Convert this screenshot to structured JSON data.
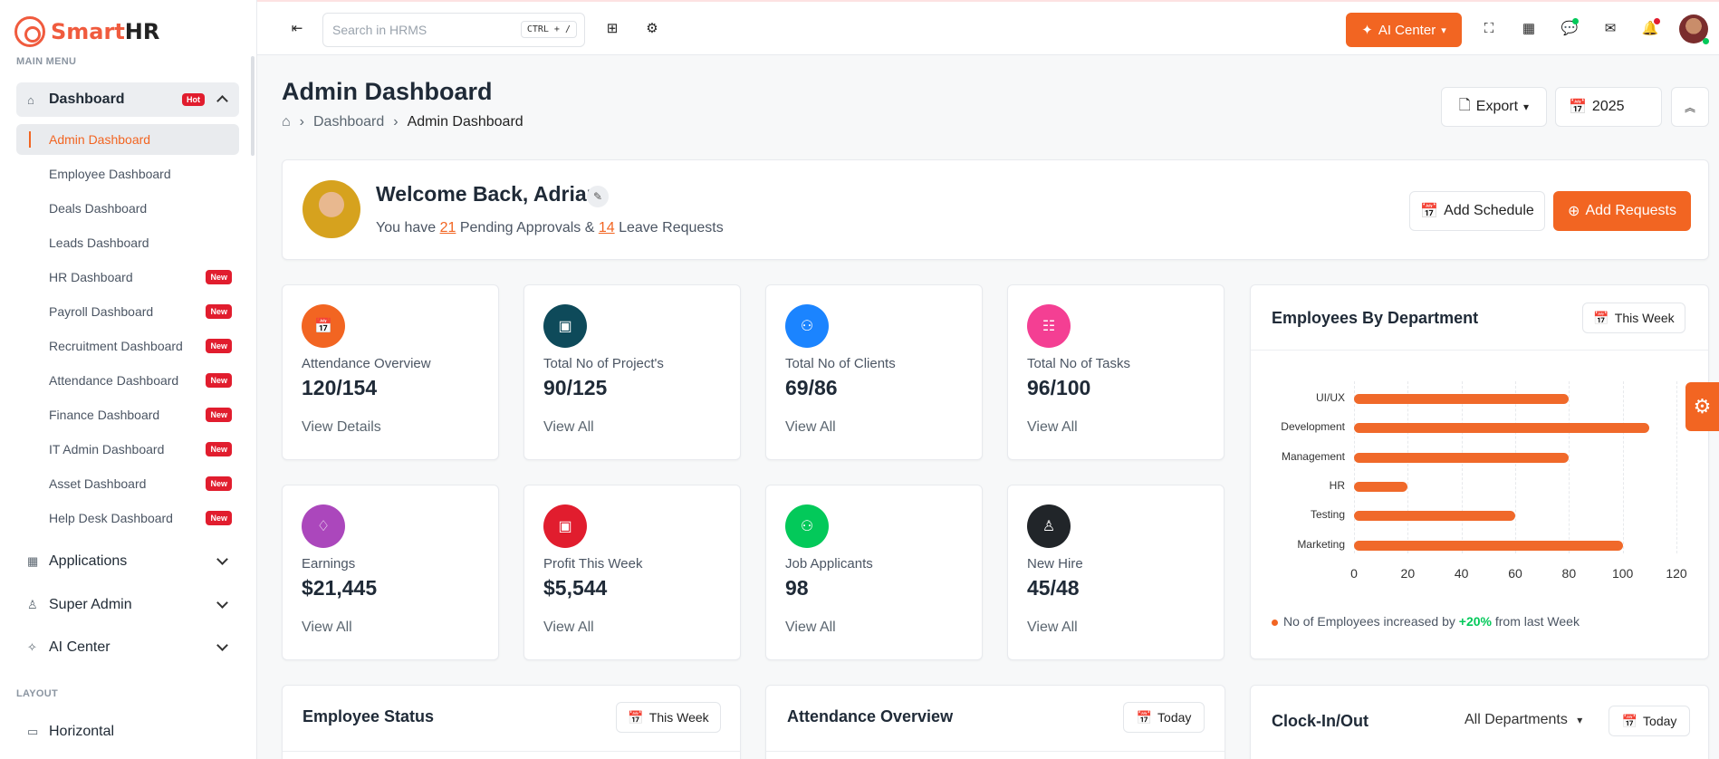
{
  "app": {
    "logo_smart": "Smart",
    "logo_hr": "HR"
  },
  "sidebar": {
    "main_menu_title": "MAIN MENU",
    "dashboard_label": "Dashboard",
    "dashboard_badge": "Hot",
    "sub_items": [
      {
        "label": "Admin Dashboard",
        "badge": ""
      },
      {
        "label": "Employee Dashboard",
        "badge": ""
      },
      {
        "label": "Deals Dashboard",
        "badge": ""
      },
      {
        "label": "Leads Dashboard",
        "badge": ""
      },
      {
        "label": "HR Dashboard",
        "badge": "New"
      },
      {
        "label": "Payroll Dashboard",
        "badge": "New"
      },
      {
        "label": "Recruitment Dashboard",
        "badge": "New"
      },
      {
        "label": "Attendance Dashboard",
        "badge": "New"
      },
      {
        "label": "Finance Dashboard",
        "badge": "New"
      },
      {
        "label": "IT Admin Dashboard",
        "badge": "New"
      },
      {
        "label": "Asset Dashboard",
        "badge": "New"
      },
      {
        "label": "Help Desk Dashboard",
        "badge": "New"
      }
    ],
    "applications_label": "Applications",
    "super_admin_label": "Super Admin",
    "ai_center_label": "AI Center",
    "layout_title": "LAYOUT",
    "horizontal_label": "Horizontal"
  },
  "topbar": {
    "search_placeholder": "Search in HRMS",
    "shortcut": "CTRL + /",
    "ai_center_label": "AI Center"
  },
  "header": {
    "title": "Admin Dashboard",
    "breadcrumb": [
      "Dashboard",
      "Admin Dashboard"
    ],
    "export_label": "Export",
    "year_label": "2025"
  },
  "welcome": {
    "title": "Welcome Back, Adrian",
    "text_prefix": "You have",
    "approvals": "21",
    "text_mid": "Pending Approvals &",
    "leaves": "14",
    "text_suffix": "Leave Requests",
    "add_schedule_label": "Add Schedule",
    "add_requests_label": "Add Requests"
  },
  "stats": [
    {
      "label": "Attendance Overview",
      "value": "120/154",
      "link": "View Details",
      "color": "#f26522"
    },
    {
      "label": "Total No of Project's",
      "value": "90/125",
      "link": "View All",
      "color": "#0e4a5a"
    },
    {
      "label": "Total No of Clients",
      "value": "69/86",
      "link": "View All",
      "color": "#1b84ff"
    },
    {
      "label": "Total No of Tasks",
      "value": "96/100",
      "link": "View All",
      "color": "#f43f93"
    },
    {
      "label": "Earnings",
      "value": "$21,445",
      "link": "View All",
      "color": "#ab47bc"
    },
    {
      "label": "Profit This Week",
      "value": "$5,544",
      "link": "View All",
      "color": "#e11d2e"
    },
    {
      "label": "Job Applicants",
      "value": "98",
      "link": "View All",
      "color": "#03c95a"
    },
    {
      "label": "New Hire",
      "value": "45/48",
      "link": "View All",
      "color": "#212529"
    }
  ],
  "dept_card": {
    "title": "Employees By Department",
    "period_label": "This Week",
    "footnote_prefix": "No of Employees increased by",
    "footnote_pct": "+20%",
    "footnote_suffix": "from last Week"
  },
  "chart_data": {
    "type": "bar",
    "orientation": "horizontal",
    "categories": [
      "UI/UX",
      "Development",
      "Management",
      "HR",
      "Testing",
      "Marketing"
    ],
    "values": [
      80,
      110,
      80,
      20,
      60,
      100
    ],
    "xlim": [
      0,
      120
    ],
    "xticks": [
      0,
      20,
      40,
      60,
      80,
      100,
      120
    ],
    "grid": true,
    "color": "#f0692a"
  },
  "bottom": {
    "employee_status_title": "Employee Status",
    "employee_status_period": "This Week",
    "attendance_title": "Attendance Overview",
    "attendance_period": "Today",
    "clock_title": "Clock-In/Out",
    "clock_filter": "All Departments",
    "clock_period": "Today"
  },
  "colors": {
    "accent": "#f26522",
    "danger": "#e11d2e",
    "success": "#03c95a"
  }
}
